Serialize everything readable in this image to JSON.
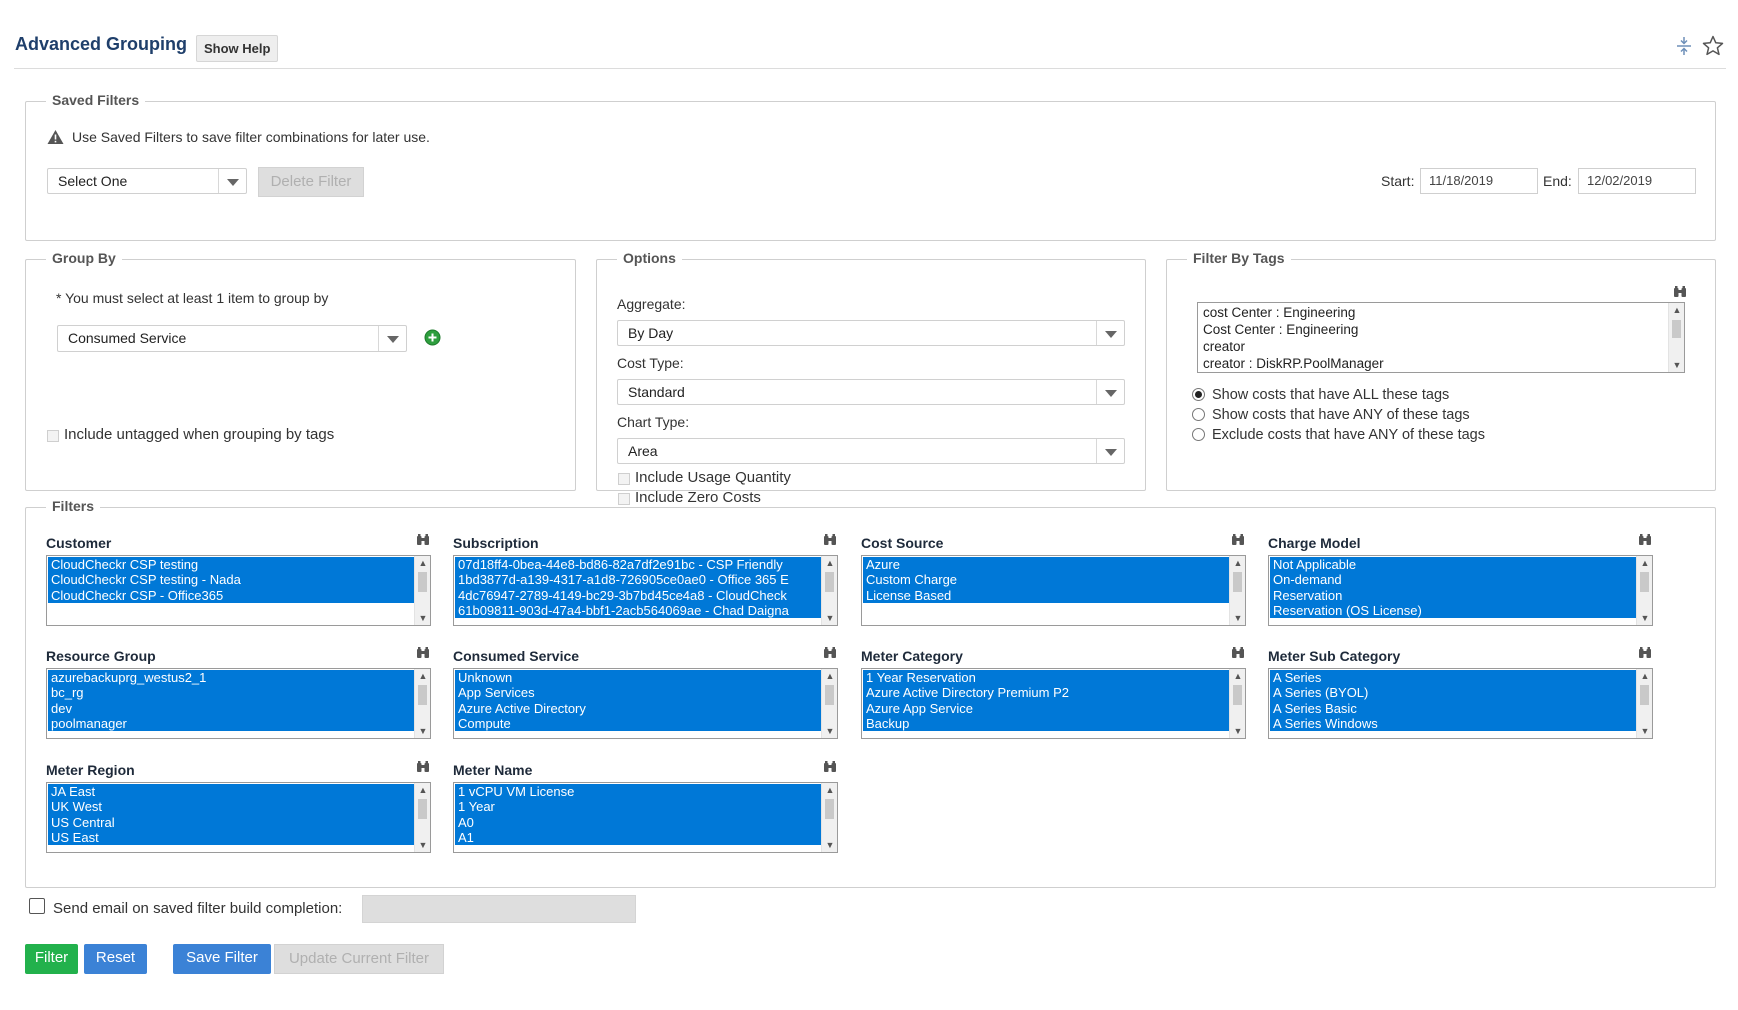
{
  "header": {
    "title": "Advanced Grouping",
    "help_label": "Show Help",
    "collapse_icon": "collapse-vertical-icon",
    "favorite_icon": "star-outline-icon"
  },
  "saved_filters": {
    "legend": "Saved Filters",
    "warning": "Use Saved Filters to save filter combinations for later use.",
    "select_value": "Select One",
    "delete_label": "Delete Filter",
    "start_label": "Start:",
    "start_value": "11/18/2019",
    "end_label": "End:",
    "end_value": "12/02/2019"
  },
  "group_by": {
    "legend": "Group By",
    "requirement": "* You must select at least 1 item to group by",
    "select_value": "Consumed Service",
    "include_untagged": "Include untagged when grouping by tags"
  },
  "options": {
    "legend": "Options",
    "aggregate_label": "Aggregate:",
    "aggregate_value": "By Day",
    "cost_type_label": "Cost Type:",
    "cost_type_value": "Standard",
    "chart_type_label": "Chart Type:",
    "chart_type_value": "Area",
    "include_usage": "Include Usage Quantity",
    "include_zero": "Include Zero Costs"
  },
  "filter_by_tags": {
    "legend": "Filter By Tags",
    "tags": [
      "cost Center : Engineering",
      "Cost Center : Engineering",
      "creator",
      "creator : DiskRP.PoolManager"
    ],
    "radio_all": "Show costs that have ALL these tags",
    "radio_any": "Show costs that have ANY of these tags",
    "radio_exclude": "Exclude costs that have ANY of these tags"
  },
  "filters": {
    "legend": "Filters",
    "customer": {
      "label": "Customer",
      "items": [
        "CloudCheckr CSP testing",
        "CloudCheckr CSP testing - Nada",
        "CloudCheckr CSP - Office365"
      ]
    },
    "subscription": {
      "label": "Subscription",
      "items": [
        "07d18ff4-0bea-44e8-bd86-82a7df2e91bc - CSP Friendly",
        "1bd3877d-a139-4317-a1d8-726905ce0ae0 - Office 365 E",
        "4dc76947-2789-4149-bc29-3b7bd45ce4a8 - CloudCheck",
        "61b09811-903d-47a4-bbf1-2acb564069ae - Chad Daigna"
      ]
    },
    "cost_source": {
      "label": "Cost Source",
      "items": [
        "Azure",
        "Custom Charge",
        "License Based"
      ]
    },
    "charge_model": {
      "label": "Charge Model",
      "items": [
        "Not Applicable",
        "On-demand",
        "Reservation",
        "Reservation (OS License)"
      ]
    },
    "resource_group": {
      "label": "Resource Group",
      "items": [
        "azurebackuprg_westus2_1",
        "bc_rg",
        "dev",
        "poolmanager"
      ]
    },
    "consumed_service": {
      "label": "Consumed Service",
      "items": [
        "Unknown",
        "App Services",
        "Azure Active Directory",
        "Compute"
      ]
    },
    "meter_category": {
      "label": "Meter Category",
      "items": [
        "1 Year Reservation",
        "Azure Active Directory Premium P2",
        "Azure App Service",
        "Backup"
      ]
    },
    "meter_sub_category": {
      "label": "Meter Sub Category",
      "items": [
        "A Series",
        "A Series (BYOL)",
        "A Series Basic",
        "A Series Windows"
      ]
    },
    "meter_region": {
      "label": "Meter Region",
      "items": [
        "JA East",
        "UK West",
        "US Central",
        "US East"
      ]
    },
    "meter_name": {
      "label": "Meter Name",
      "items": [
        "1 vCPU VM License",
        "1 Year",
        "A0",
        "A1"
      ]
    }
  },
  "email": {
    "label": "Send email on saved filter build completion:",
    "value": ""
  },
  "actions": {
    "filter": "Filter",
    "reset": "Reset",
    "save": "Save Filter",
    "update": "Update Current Filter"
  },
  "colors": {
    "selection": "#0078d7",
    "filter_btn": "#22b14c",
    "primary_btn": "#3b82d6",
    "title": "#1f3f6b"
  }
}
